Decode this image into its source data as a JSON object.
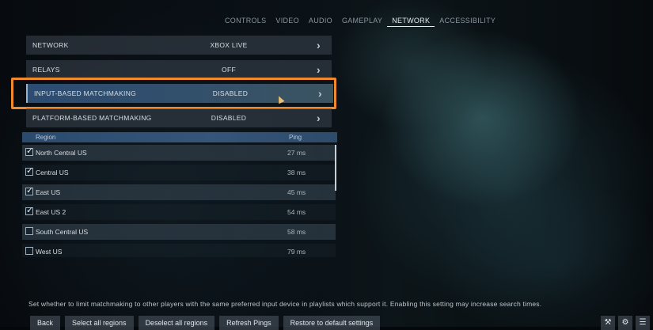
{
  "tabs": [
    {
      "label": "CONTROLS",
      "active": false
    },
    {
      "label": "VIDEO",
      "active": false
    },
    {
      "label": "AUDIO",
      "active": false
    },
    {
      "label": "GAMEPLAY",
      "active": false
    },
    {
      "label": "NETWORK",
      "active": true
    },
    {
      "label": "ACCESSIBILITY",
      "active": false
    }
  ],
  "settings": [
    {
      "label": "NETWORK",
      "value": "XBOX LIVE"
    },
    {
      "label": "RELAYS",
      "value": "OFF"
    },
    {
      "label": "INPUT-BASED MATCHMAKING",
      "value": "DISABLED"
    },
    {
      "label": "PLATFORM-BASED MATCHMAKING",
      "value": "DISABLED"
    }
  ],
  "region_table": {
    "header_region": "Region",
    "header_ping": "Ping",
    "rows": [
      {
        "name": "North Central US",
        "ping": "27  ms",
        "checked": true
      },
      {
        "name": "Central US",
        "ping": "38  ms",
        "checked": true
      },
      {
        "name": "East US",
        "ping": "45  ms",
        "checked": true
      },
      {
        "name": "East US 2",
        "ping": "54  ms",
        "checked": true
      },
      {
        "name": "South Central US",
        "ping": "58  ms",
        "checked": false
      },
      {
        "name": "West US",
        "ping": "79  ms",
        "checked": false
      }
    ]
  },
  "hint": "Set whether to limit matchmaking to other players with the same preferred input device in playlists which support it. Enabling this setting may increase search times.",
  "buttons": {
    "back": "Back",
    "select_all": "Select all regions",
    "deselect_all": "Deselect all regions",
    "refresh": "Refresh Pings",
    "restore": "Restore to default settings"
  },
  "icons": [
    "wrench-icon",
    "gear-icon",
    "chat-icon"
  ]
}
